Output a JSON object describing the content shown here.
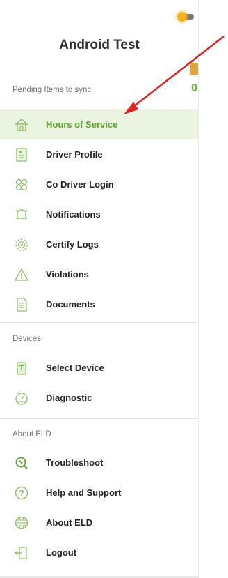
{
  "app": {
    "title": "Android Test"
  },
  "pending": {
    "label": "Pending Items to sync",
    "count": "0"
  },
  "menu": [
    {
      "label": "Hours of Service",
      "icon": "home-icon",
      "active": true
    },
    {
      "label": "Driver Profile",
      "icon": "profile-icon"
    },
    {
      "label": "Co Driver Login",
      "icon": "co-driver-icon"
    },
    {
      "label": "Notifications",
      "icon": "bell-icon"
    },
    {
      "label": "Certify Logs",
      "icon": "certify-icon"
    },
    {
      "label": "Violations",
      "icon": "warning-icon"
    },
    {
      "label": "Documents",
      "icon": "document-icon"
    }
  ],
  "devices": {
    "label": "Devices",
    "items": [
      {
        "label": "Select Device",
        "icon": "device-icon"
      },
      {
        "label": "Diagnostic",
        "icon": "gauge-icon"
      }
    ]
  },
  "about": {
    "label": "About ELD",
    "items": [
      {
        "label": "Troubleshoot",
        "icon": "troubleshoot-icon"
      },
      {
        "label": "Help and Support",
        "icon": "help-icon"
      },
      {
        "label": "About ELD",
        "icon": "globe-icon"
      },
      {
        "label": "Logout",
        "icon": "logout-icon"
      }
    ]
  },
  "colors": {
    "accent": "#5aa62c",
    "active_bg": "#eaf4e0",
    "annotation": "#e32121"
  }
}
